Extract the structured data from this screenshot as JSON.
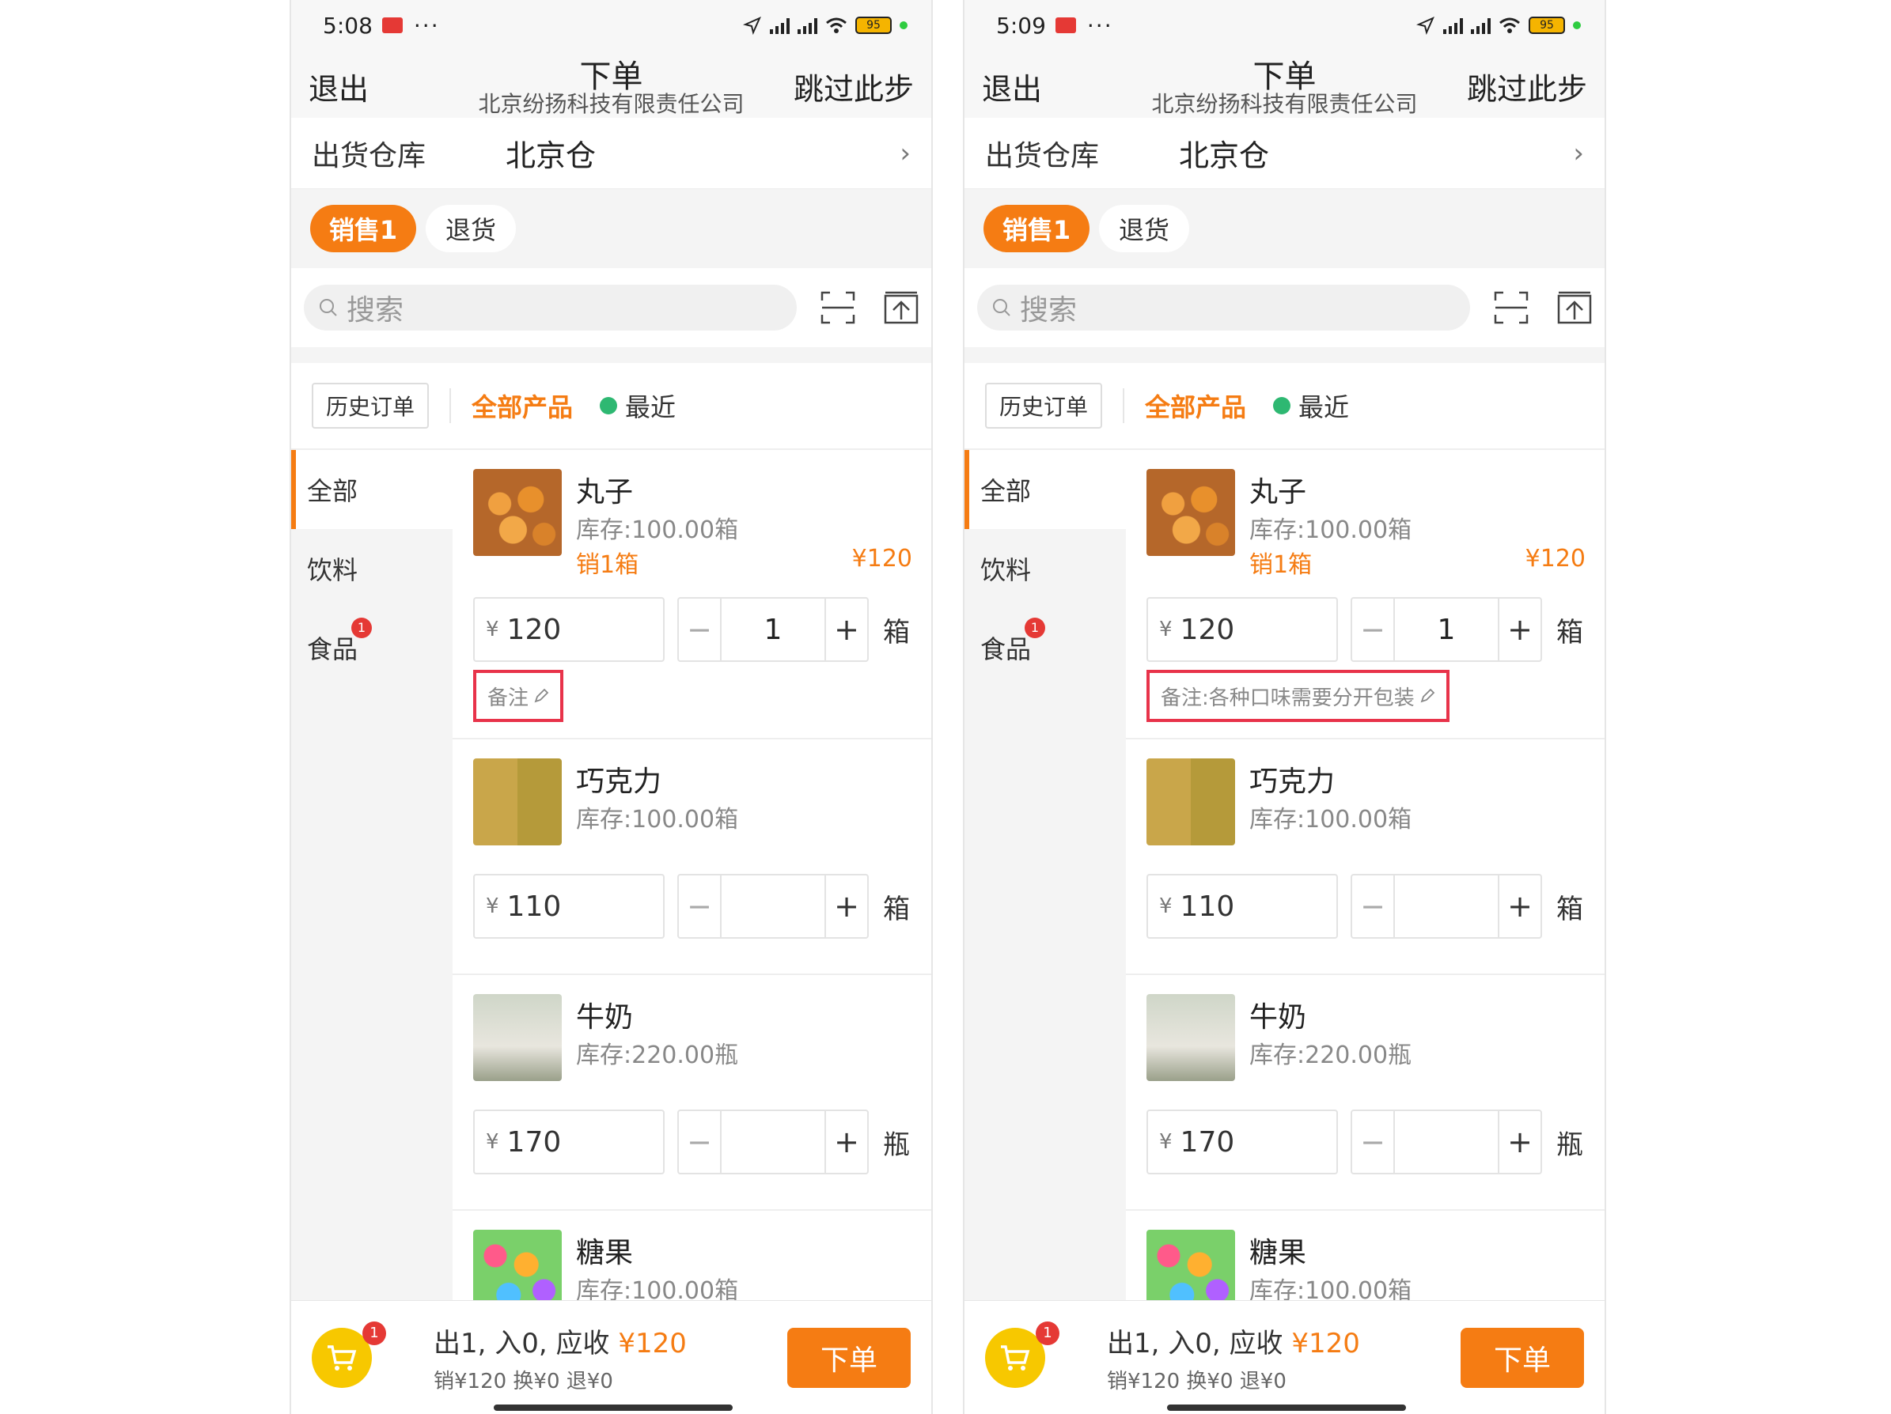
{
  "screens": [
    {
      "status": {
        "time": "5:08",
        "dots": "···",
        "battery": "95"
      },
      "nav": {
        "back": "退出",
        "title": "下单",
        "subtitle": "北京纷扬科技有限责任公司",
        "skip": "跳过此步"
      },
      "warehouse": {
        "label": "出货仓库",
        "value": "北京仓",
        "chevron": "›"
      },
      "type_tabs": [
        "销售1",
        "退货"
      ],
      "search": {
        "placeholder": "搜索"
      },
      "tabs": {
        "history": "历史订单",
        "all": "全部产品",
        "recent": "最近"
      },
      "categories": [
        {
          "label": "全部"
        },
        {
          "label": "饮料"
        },
        {
          "label": "食品",
          "badge": "1"
        }
      ],
      "products": [
        {
          "name": "丸子",
          "stock": "库存:100.00箱",
          "sales": "销1箱",
          "amount": "¥120",
          "price": "120",
          "qty": "1",
          "unit": "箱",
          "remark": "备注"
        },
        {
          "name": "巧克力",
          "stock": "库存:100.00箱",
          "price": "110",
          "qty": "",
          "unit": "箱"
        },
        {
          "name": "牛奶",
          "stock": "库存:220.00瓶",
          "price": "170",
          "qty": "",
          "unit": "瓶"
        },
        {
          "name": "糖果",
          "stock": "库存:100.00箱"
        }
      ],
      "footer": {
        "cart_badge": "1",
        "summary_prefix": "出1, 入0, 应收",
        "summary_amount": "¥120",
        "summary_sub": "销¥120 换¥0 退¥0",
        "order": "下单"
      }
    },
    {
      "status": {
        "time": "5:09",
        "dots": "···",
        "battery": "95"
      },
      "nav": {
        "back": "退出",
        "title": "下单",
        "subtitle": "北京纷扬科技有限责任公司",
        "skip": "跳过此步"
      },
      "warehouse": {
        "label": "出货仓库",
        "value": "北京仓",
        "chevron": "›"
      },
      "type_tabs": [
        "销售1",
        "退货"
      ],
      "search": {
        "placeholder": "搜索"
      },
      "tabs": {
        "history": "历史订单",
        "all": "全部产品",
        "recent": "最近"
      },
      "categories": [
        {
          "label": "全部"
        },
        {
          "label": "饮料"
        },
        {
          "label": "食品",
          "badge": "1"
        }
      ],
      "products": [
        {
          "name": "丸子",
          "stock": "库存:100.00箱",
          "sales": "销1箱",
          "amount": "¥120",
          "price": "120",
          "qty": "1",
          "unit": "箱",
          "remark": "备注:各种口味需要分开包装"
        },
        {
          "name": "巧克力",
          "stock": "库存:100.00箱",
          "price": "110",
          "qty": "",
          "unit": "箱"
        },
        {
          "name": "牛奶",
          "stock": "库存:220.00瓶",
          "price": "170",
          "qty": "",
          "unit": "瓶"
        },
        {
          "name": "糖果",
          "stock": "库存:100.00箱"
        }
      ],
      "footer": {
        "cart_badge": "1",
        "summary_prefix": "出1, 入0, 应收",
        "summary_amount": "¥120",
        "summary_sub": "销¥120 换¥0 退¥0",
        "order": "下单"
      }
    }
  ],
  "colors": {
    "accent": "#f57c13",
    "badge": "#e53935",
    "highlight": "#e8334a",
    "cart": "#f7c800"
  },
  "currency_symbol": "¥"
}
